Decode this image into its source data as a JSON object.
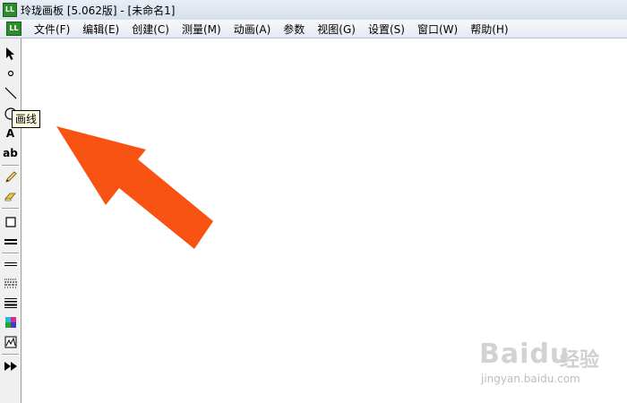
{
  "window": {
    "title": "玲珑画板 [5.062版] - [未命名1]",
    "app_icon_text": "LL"
  },
  "menu": {
    "items": [
      "文件(F)",
      "编辑(E)",
      "创建(C)",
      "测量(M)",
      "动画(A)",
      "参数",
      "视图(G)",
      "设置(S)",
      "窗口(W)",
      "帮助(H)"
    ]
  },
  "toolbar": {
    "tools": [
      {
        "name": "select-tool",
        "icon": "cursor-arrow-icon"
      },
      {
        "name": "point-tool",
        "icon": "point-icon"
      },
      {
        "name": "line-tool",
        "icon": "line-icon"
      },
      {
        "name": "circle-tool",
        "icon": "circle-icon"
      },
      {
        "name": "text-tool",
        "icon": "letter-a-icon",
        "label": "A"
      },
      {
        "name": "label-tool",
        "icon": "ab-text-icon",
        "label": "ab"
      },
      {
        "name": "pencil-tool",
        "icon": "pencil-icon"
      },
      {
        "name": "eraser-tool",
        "icon": "eraser-icon"
      },
      {
        "name": "rectangle-tool",
        "icon": "square-icon"
      },
      {
        "name": "thick-line-tool",
        "icon": "thick-line-icon"
      },
      {
        "name": "thin-line-tool",
        "icon": "double-line-icon"
      },
      {
        "name": "dotted-line-tool",
        "icon": "dotted-line-icon"
      },
      {
        "name": "line-weight-tool",
        "icon": "line-weight-icon"
      },
      {
        "name": "color-tool",
        "icon": "color-palette-icon"
      },
      {
        "name": "graph-tool",
        "icon": "graph-icon"
      },
      {
        "name": "animation-tool",
        "icon": "fast-forward-icon"
      }
    ]
  },
  "tooltip": {
    "text": "画线"
  },
  "annotation": {
    "arrow_color": "#f95314"
  },
  "watermark": {
    "logo": "Baidu",
    "cn": "经验",
    "url": "jingyan.baidu.com"
  }
}
